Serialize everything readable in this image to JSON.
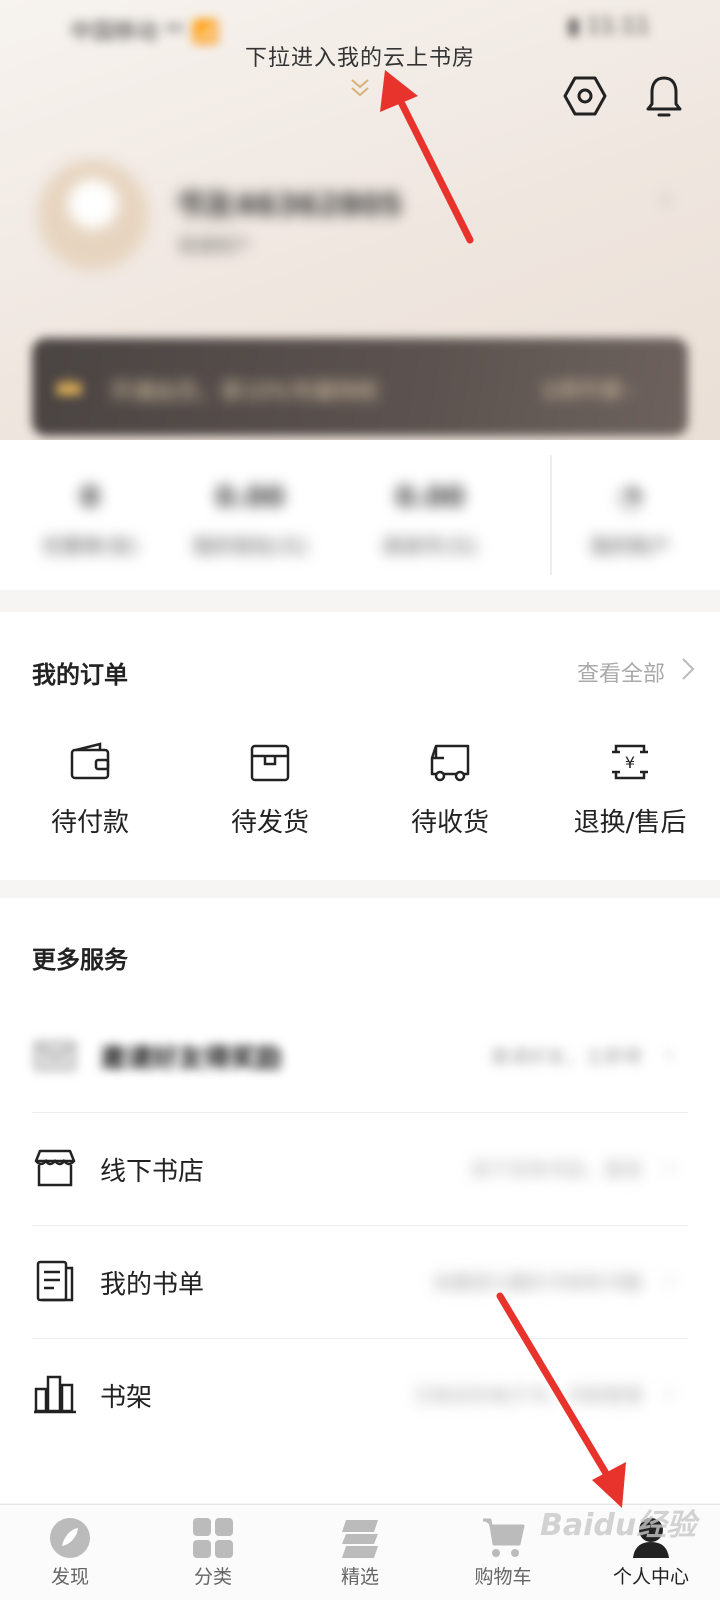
{
  "status_bar": {
    "left": "中国移动 ⁴ᴳ 📶",
    "right": "▮ 11:11"
  },
  "pull_hint": "下拉进入我的云上书房",
  "profile": {
    "username": "书友46362805",
    "type": "普通用户"
  },
  "vip_banner": {
    "text": "开通会员，享10%专属特权",
    "action": "立即开通 ›"
  },
  "stats": [
    {
      "value": "0",
      "label": "优惠券(张)"
    },
    {
      "value": "0.00",
      "label": "我的钱包(元)"
    },
    {
      "value": "0.00",
      "label": "阅读币(元)"
    },
    {
      "value": "",
      "label": "我的账户"
    }
  ],
  "orders": {
    "title": "我的订单",
    "view_all": "查看全部",
    "items": [
      {
        "label": "待付款",
        "icon": "wallet-icon"
      },
      {
        "label": "待发货",
        "icon": "box-icon"
      },
      {
        "label": "待收货",
        "icon": "truck-icon"
      },
      {
        "label": "退换/售后",
        "icon": "refund-icon"
      }
    ]
  },
  "services": {
    "title": "更多服务",
    "items": [
      {
        "label": "邀请好友得奖励",
        "desc": "邀请好友，立即得",
        "icon": "mail-icon",
        "blurred": true
      },
      {
        "label": "线下书店",
        "desc": "线下实体书店，查找",
        "icon": "store-icon",
        "blurred": false
      },
      {
        "label": "我的书单",
        "desc": "收藏感兴趣的书单和书籍",
        "icon": "booklist-icon",
        "blurred": false
      },
      {
        "label": "书架",
        "desc": "已购买的电子书，书架管理",
        "icon": "bookshelf-icon",
        "blurred": false
      }
    ]
  },
  "bottom_nav": [
    {
      "label": "发现",
      "icon": "compass-icon"
    },
    {
      "label": "分类",
      "icon": "grid-icon"
    },
    {
      "label": "精选",
      "icon": "selection-icon"
    },
    {
      "label": "购物车",
      "icon": "cart-icon"
    },
    {
      "label": "个人中心",
      "icon": "user-icon",
      "active": true
    }
  ],
  "watermark": "Baidu经验",
  "colors": {
    "annotation_arrow": "#e8332c",
    "vip_gold": "#e8d3b0",
    "accent_chevron": "#d9b27a"
  }
}
